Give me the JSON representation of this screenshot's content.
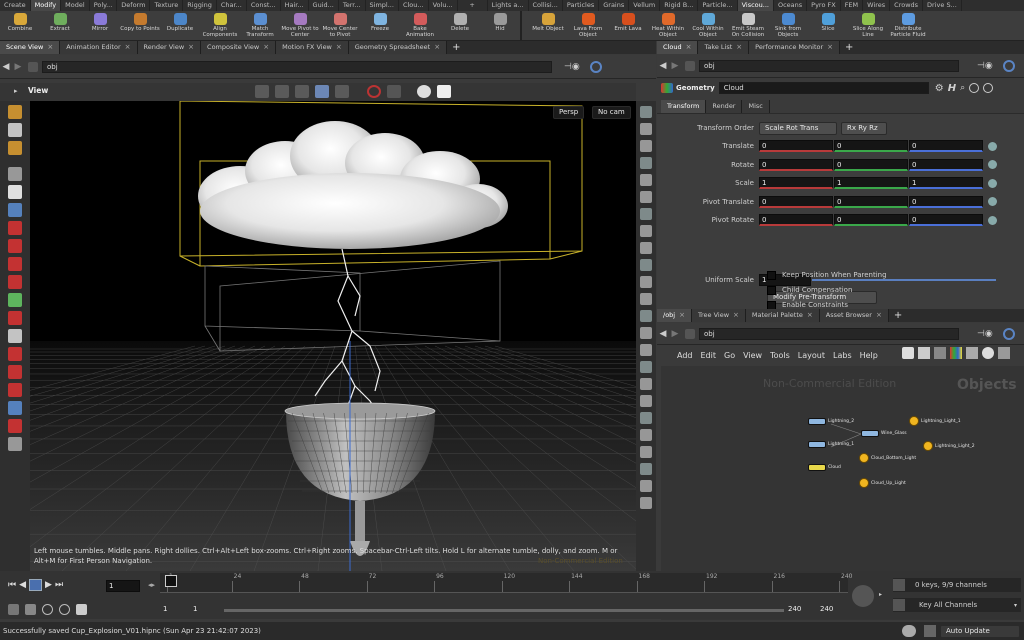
{
  "shelf_tabs": [
    "Create",
    "Modify",
    "Model",
    "Poly...",
    "Deform",
    "Texture",
    "Rigging",
    "Char...",
    "Const...",
    "Hair...",
    "Guid...",
    "Terr...",
    "Simpl...",
    "Clou...",
    "Volu...",
    "Lights a...",
    "Collisi...",
    "Particles",
    "Grains",
    "Vellum",
    "Rigid B...",
    "Particle...",
    "Viscou...",
    "Oceans",
    "Pyro FX",
    "FEM",
    "Wires",
    "Crowds",
    "Drive S..."
  ],
  "shelf_tools_left": [
    {
      "label": "Combine",
      "icon": "combine-icon",
      "color": "#d9a83a"
    },
    {
      "label": "Extract",
      "icon": "extract-icon",
      "color": "#6fae5d"
    },
    {
      "label": "Mirror",
      "icon": "mirror-icon",
      "color": "#8a7ad8"
    },
    {
      "label": "Copy to Points",
      "icon": "copy-icon",
      "color": "#c47a2e"
    },
    {
      "label": "Duplicate",
      "icon": "duplicate-icon",
      "color": "#4c86c9"
    },
    {
      "label": "Align Components",
      "icon": "align-icon",
      "color": "#cfc33c"
    },
    {
      "label": "Match Transform",
      "icon": "match-icon",
      "color": "#5b8fd1"
    },
    {
      "label": "Move Pivot to Center",
      "icon": "pivot-icon",
      "color": "#a57ac0"
    },
    {
      "label": "Move Center to Pivot",
      "icon": "center-icon",
      "color": "#d3736e"
    },
    {
      "label": "Freeze",
      "icon": "freeze-icon",
      "color": "#7fb4e0"
    },
    {
      "label": "Bake Animation",
      "icon": "bake-icon",
      "color": "#d35b5b"
    },
    {
      "label": "Delete",
      "icon": "delete-icon",
      "color": "#b0b0b0"
    },
    {
      "label": "Hid",
      "icon": "hide-icon",
      "color": "#9a9a9a"
    }
  ],
  "shelf_tools_right": [
    {
      "label": "Melt Object",
      "icon": "melt-icon",
      "color": "#d7a33a"
    },
    {
      "label": "Lava From Object",
      "icon": "lava-icon",
      "color": "#e05a1f"
    },
    {
      "label": "Emit Lava",
      "icon": "emit-lava-icon",
      "color": "#d74f1d"
    },
    {
      "label": "Heat Within Object",
      "icon": "heat-icon",
      "color": "#e0692a"
    },
    {
      "label": "Cool Within Object",
      "icon": "cool-icon",
      "color": "#5fa8d8"
    },
    {
      "label": "Emit Steam On Collision",
      "icon": "steam-icon",
      "color": "#c9c9c9"
    },
    {
      "label": "Sink from Objects",
      "icon": "sink-icon",
      "color": "#4c8ad1"
    },
    {
      "label": "Slice",
      "icon": "slice-icon",
      "color": "#4f9fd9"
    },
    {
      "label": "Slice Along Line",
      "icon": "slice-line-icon",
      "color": "#8fc24d"
    },
    {
      "label": "Distribute Particle Fluid",
      "icon": "distribute-icon",
      "color": "#5d9be0"
    }
  ],
  "left_pane_tabs": [
    "Scene View",
    "Animation Editor",
    "Render View",
    "Composite View",
    "Motion FX View",
    "Geometry Spreadsheet"
  ],
  "left_path": "obj",
  "viewport": {
    "title": "View",
    "persp": "Persp",
    "cam": "No cam",
    "help_line1": "Left mouse tumbles. Middle pans. Right dollies. Ctrl+Alt+Left box-zooms. Ctrl+Right zooms. Spacebar-Ctrl-Left tilts. Hold L for alternate tumble, dolly, and zoom.    M or",
    "help_line2": "Alt+M for First Person Navigation.",
    "watermark": "Non-Commercial Edition"
  },
  "param_tabs": [
    "Cloud",
    "Take List",
    "Performance Monitor"
  ],
  "param_path": "obj",
  "geometry": {
    "type_label": "Geometry",
    "name": "Cloud"
  },
  "param_subtabs": [
    "Transform",
    "Render",
    "Misc"
  ],
  "transform_order": {
    "label": "Transform Order",
    "value1": "Scale Rot Trans",
    "value2": "Rx Ry Rz"
  },
  "params": [
    {
      "label": "Translate",
      "values": [
        "0",
        "0",
        "0"
      ]
    },
    {
      "label": "Rotate",
      "values": [
        "0",
        "0",
        "0"
      ]
    },
    {
      "label": "Scale",
      "values": [
        "1",
        "1",
        "1"
      ]
    },
    {
      "label": "Pivot Translate",
      "values": [
        "0",
        "0",
        "0"
      ]
    },
    {
      "label": "Pivot Rotate",
      "values": [
        "0",
        "0",
        "0"
      ]
    }
  ],
  "uniform_scale": {
    "label": "Uniform Scale",
    "value": "1"
  },
  "modify_pre": "Modify Pre-Transform",
  "checkboxes": [
    "Keep Position When Parenting",
    "Child Compensation",
    "Enable Constraints"
  ],
  "net_tabs": [
    "/obj",
    "Tree View",
    "Material Palette",
    "Asset Browser"
  ],
  "net_path": "obj",
  "net_menu": [
    "Add",
    "Edit",
    "Go",
    "View",
    "Tools",
    "Layout",
    "Labs",
    "Help"
  ],
  "net_watermark": "Non-Commercial Edition",
  "net_context": "Objects",
  "nodes": [
    {
      "name": "Lightning_2",
      "kind": "geo",
      "color": "#8fb7e0"
    },
    {
      "name": "Wine_Glass",
      "kind": "geo",
      "color": "#8fb7e0"
    },
    {
      "name": "Lightning_1",
      "kind": "geo",
      "color": "#8fb7e0"
    },
    {
      "name": "Cloud",
      "kind": "geo",
      "color": "#e8d84a"
    },
    {
      "name": "Lightning_Light_1",
      "kind": "light"
    },
    {
      "name": "Lightning_Light_2",
      "kind": "light"
    },
    {
      "name": "Cloud_Bottom_Light",
      "kind": "light"
    },
    {
      "name": "Cloud_Up_Light",
      "kind": "light"
    }
  ],
  "timeline": {
    "ticks": [
      "1",
      "24",
      "48",
      "72",
      "96",
      "120",
      "144",
      "168",
      "192",
      "216",
      "240"
    ],
    "current_frame": "1",
    "start": "1",
    "range_start": "1",
    "range_end": "240",
    "end": "240",
    "keys_info": "0 keys, 9/9 channels",
    "key_all": "Key All Channels"
  },
  "status": {
    "message": "Successfully saved Cup_Explosion_V01.hipnc (Sun Apr 23 21:42:07 2023)",
    "auto_update": "Auto Update"
  }
}
